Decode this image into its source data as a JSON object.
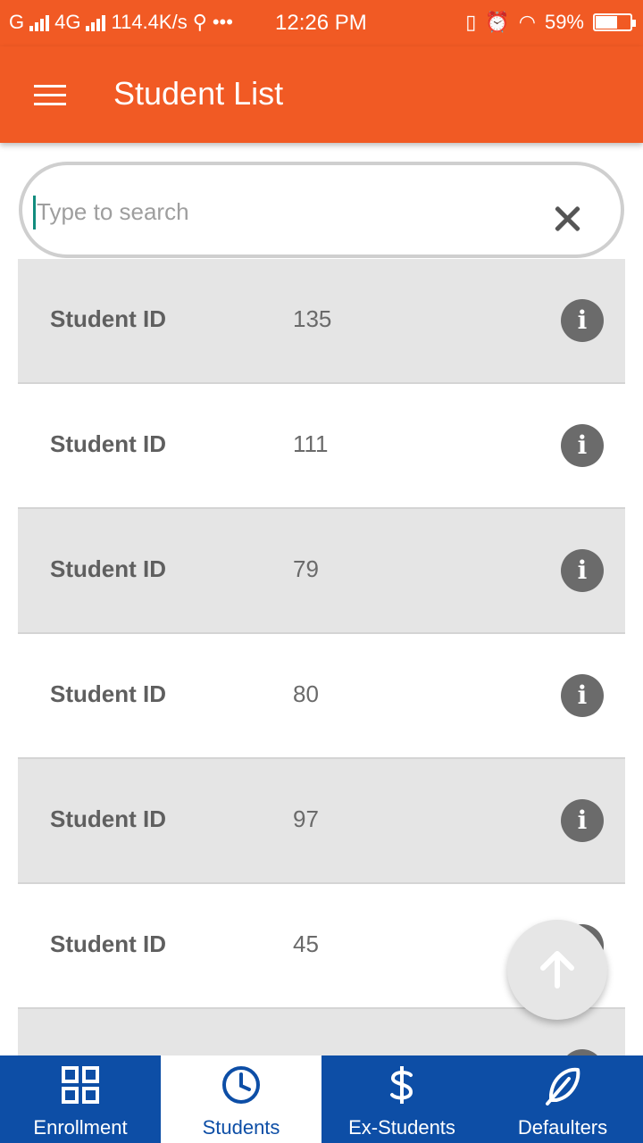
{
  "status_bar": {
    "network_left": "G",
    "network_4g": "4G",
    "speed": "114.4K/s",
    "dots": "•••",
    "time": "12:26 PM",
    "battery": "59%"
  },
  "app_bar": {
    "title": "Student List"
  },
  "search": {
    "placeholder": "Type to search",
    "value": ""
  },
  "list": {
    "items": [
      {
        "label": "Student ID",
        "value": "135"
      },
      {
        "label": "Student ID",
        "value": "111"
      },
      {
        "label": "Student ID",
        "value": "79"
      },
      {
        "label": "Student ID",
        "value": "80"
      },
      {
        "label": "Student ID",
        "value": "97"
      },
      {
        "label": "Student ID",
        "value": "45"
      }
    ]
  },
  "bottom_nav": {
    "tabs": [
      {
        "label": "Enrollment",
        "icon": "grid-icon"
      },
      {
        "label": "Students",
        "icon": "clock-icon",
        "active": true
      },
      {
        "label": "Ex-Students",
        "icon": "dollar-icon"
      },
      {
        "label": "Defaulters",
        "icon": "feather-icon"
      }
    ]
  },
  "colors": {
    "app_bar": "#f15a24",
    "bottom_nav": "#0d4ea6",
    "row_shaded": "#e5e5e5"
  }
}
